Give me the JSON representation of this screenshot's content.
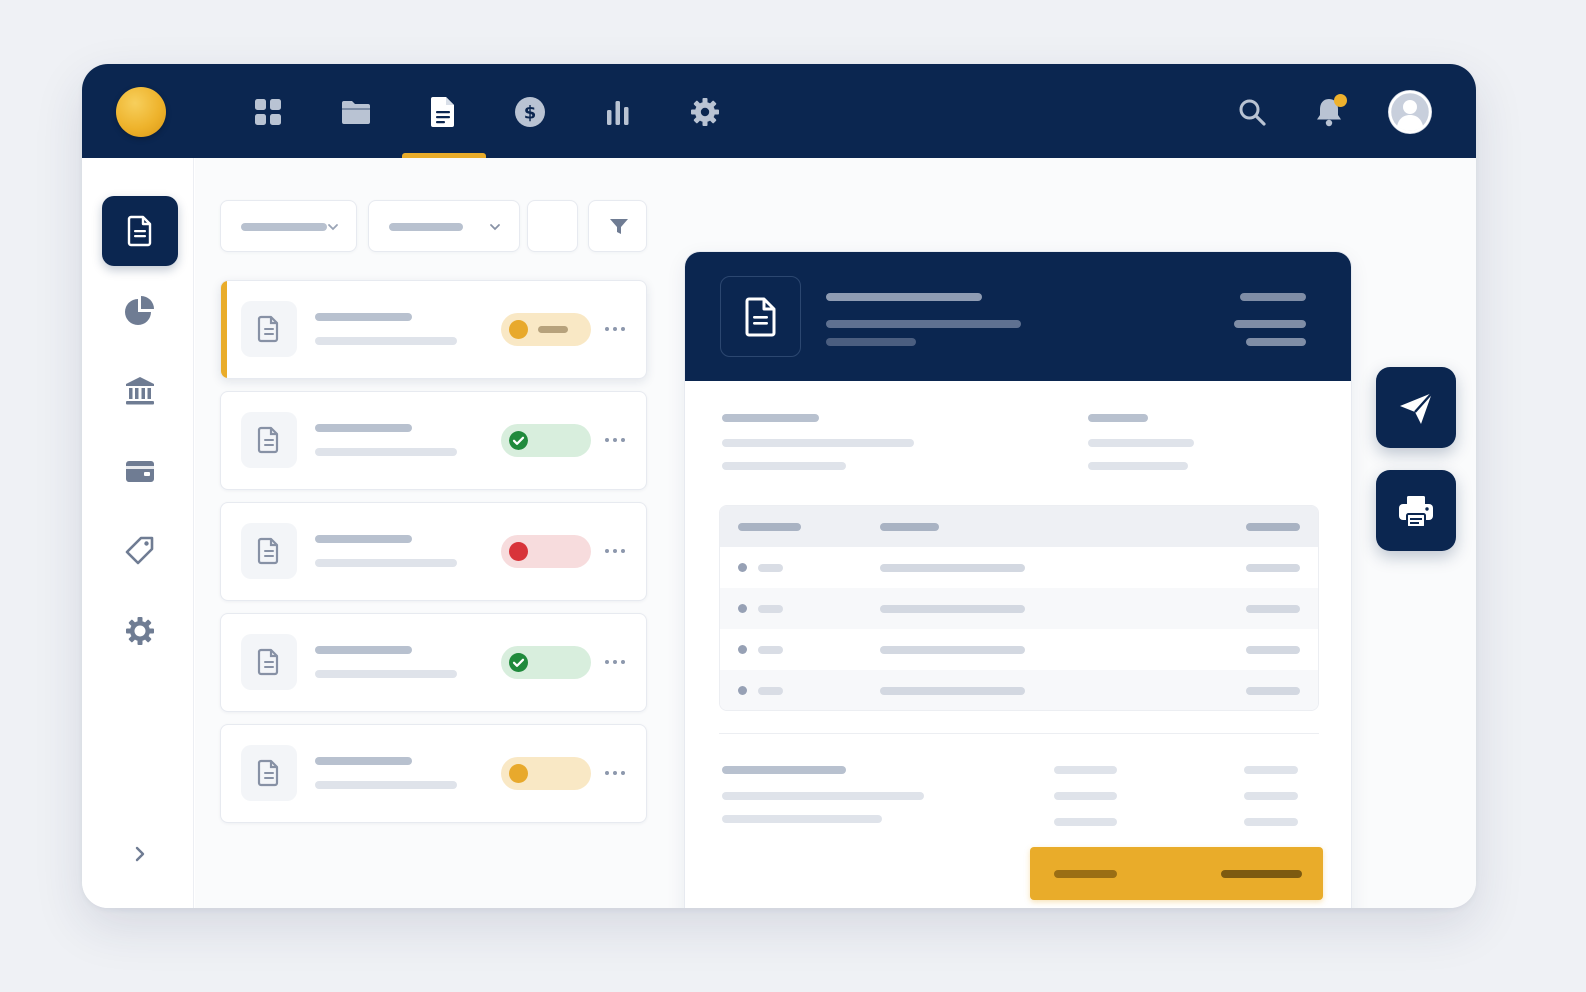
{
  "colors": {
    "navy": "#0b2650",
    "accent": "#e9ac2a",
    "background": "#eff1f5",
    "status_pending": "#e8a92c",
    "status_paid": "#208a3c",
    "status_overdue": "#d8343a"
  },
  "topnav": {
    "items": [
      {
        "icon": "grid-icon",
        "active": false
      },
      {
        "icon": "folder-icon",
        "active": false
      },
      {
        "icon": "document-icon",
        "active": true
      },
      {
        "icon": "dollar-icon",
        "active": false
      },
      {
        "icon": "bar-chart-icon",
        "active": false
      },
      {
        "icon": "gear-icon",
        "active": false
      }
    ],
    "actions": [
      "search-icon",
      "bell-icon",
      "user-avatar-icon"
    ]
  },
  "sidebar": {
    "items": [
      {
        "icon": "document-icon",
        "active": true
      },
      {
        "icon": "pie-chart-icon",
        "active": false
      },
      {
        "icon": "bank-icon",
        "active": false
      },
      {
        "icon": "wallet-icon",
        "active": false
      },
      {
        "icon": "tag-icon",
        "active": false
      },
      {
        "icon": "gear-icon",
        "active": false
      }
    ],
    "expand_icon": "chevron-right-icon"
  },
  "filters": [
    {
      "type": "dropdown",
      "icon": "chevron-down-icon"
    },
    {
      "type": "dropdown",
      "icon": "chevron-down-icon"
    },
    {
      "type": "blank"
    },
    {
      "type": "button",
      "icon": "funnel-icon"
    }
  ],
  "invoice_list": [
    {
      "status": "pending",
      "selected": true
    },
    {
      "status": "paid",
      "selected": false
    },
    {
      "status": "overdue",
      "selected": false
    },
    {
      "status": "paid",
      "selected": false
    },
    {
      "status": "pending",
      "selected": false
    }
  ],
  "detail": {
    "header_icon": "document-icon",
    "line_items_count": 4
  },
  "floating_actions": [
    "send-icon",
    "printer-icon"
  ]
}
